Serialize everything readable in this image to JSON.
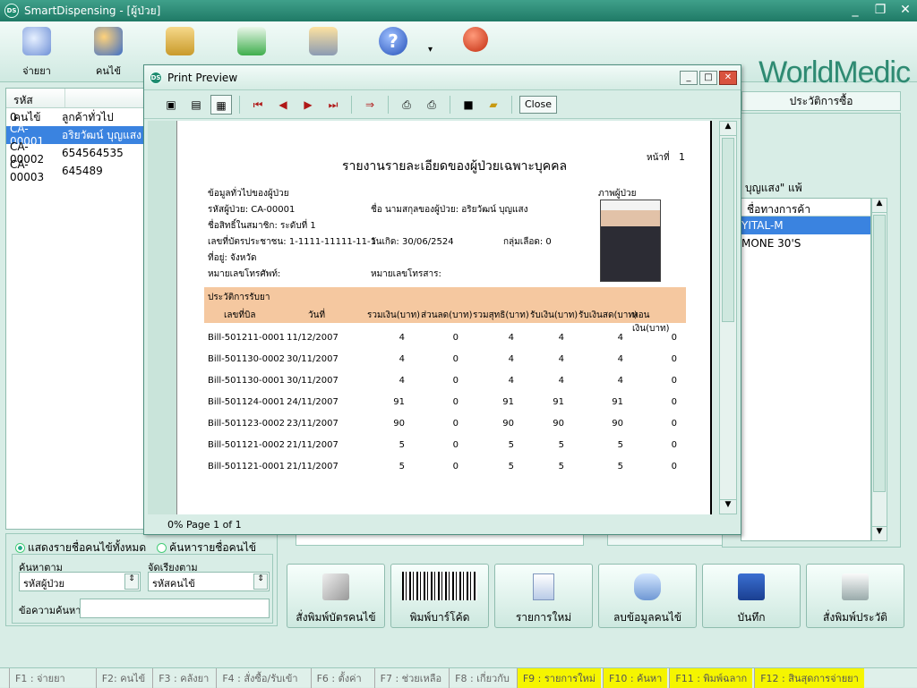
{
  "window": {
    "title": "SmartDispensing - [ผู้ป่วย]",
    "app_icon": "DS",
    "minimize": "_",
    "restore": "❐",
    "close": "✕"
  },
  "toolbar": {
    "buttons": [
      {
        "label": "จ่ายยา",
        "icon": "dispense-icon"
      },
      {
        "label": "คนไข้",
        "icon": "patients-icon"
      },
      {
        "label": "",
        "icon": "stock-icon"
      },
      {
        "label": "",
        "icon": "transfer-icon"
      },
      {
        "label": "",
        "icon": "tools-icon"
      },
      {
        "label": "",
        "icon": "help-icon"
      },
      {
        "label": "",
        "icon": "power-icon"
      }
    ],
    "logo": "WorldMedic"
  },
  "patient_list": {
    "columns": [
      "รหัสคนไข้",
      ""
    ],
    "rows": [
      {
        "code": "0",
        "name": "ลูกค้าทั่วไป"
      },
      {
        "code": "CA-00001",
        "name": "อริยวัฒน์ บุญแสง"
      },
      {
        "code": "CA-00002",
        "name": "654564535"
      },
      {
        "code": "CA-00003",
        "name": "645489"
      }
    ],
    "selected_index": 1
  },
  "search": {
    "radio_all": "แสดงรายชื่อคนไข้ทั้งหมด",
    "radio_search": "ค้นหารายชื่อคนไข้",
    "search_by_label": "ค้นหาตาม",
    "search_by_value": "รหัสผู้ป่วย",
    "sort_by_label": "จัดเรียงตาม",
    "sort_by_value": "รหัสคนไข้",
    "keyword_label": "ข้อความค้นหา",
    "keyword_value": ""
  },
  "right": {
    "tab_label": "ประวัติการซื้อ",
    "group_caption": "ณ์ บุญแสง\" แพ้",
    "allergy_header": "ชื่อทางการค้า",
    "allergy_rows": [
      "YITAL-M",
      "MONE 30'S"
    ]
  },
  "bottom_buttons": [
    {
      "label": "สั่งพิมพ์บัตรคนไข้",
      "icon": "print-card-icon"
    },
    {
      "label": "พิมพ์บาร์โค้ด",
      "icon": "barcode-icon"
    },
    {
      "label": "รายการใหม่",
      "icon": "new-document-icon"
    },
    {
      "label": "ลบข้อมูลคนไข้",
      "icon": "delete-database-icon"
    },
    {
      "label": "บันทึก",
      "icon": "save-icon"
    },
    {
      "label": "สั่งพิมพ์ประวัติ",
      "icon": "printer-icon"
    }
  ],
  "fkeys": [
    {
      "label": "F1 : จ่ายยา",
      "hl": false
    },
    {
      "label": "F2: คนไข้",
      "hl": false
    },
    {
      "label": "F3 : คลังยา",
      "hl": false
    },
    {
      "label": "F4 : สั่งซื้อ/รับเข้า",
      "hl": false
    },
    {
      "label": "F6 : ตั้งค่า",
      "hl": false
    },
    {
      "label": "F7 : ช่วยเหลือ",
      "hl": false
    },
    {
      "label": "F8 : เกี่ยวกับ",
      "hl": false
    },
    {
      "label": "F9 : รายการใหม่",
      "hl": true
    },
    {
      "label": "F10 : ค้นหา",
      "hl": true
    },
    {
      "label": "F11 : พิมพ์ฉลาก",
      "hl": true
    },
    {
      "label": "F12 : สินสุดการจ่ายยา",
      "hl": true
    }
  ],
  "preview": {
    "title": "Print Preview",
    "icon": "DS",
    "close_label": "Close",
    "status": "0% Page 1 of 1",
    "report": {
      "page_label": "หน้าที่",
      "page_no": "1",
      "title": "รายงานรายละเอียดของผู้ป่วยเฉพาะบุคคล",
      "general_info": "ข้อมูลทั่วไปของผู้ป่วย",
      "photo_label": "ภาพผู้ป่วย",
      "patient_code": "รหัสผู้ป่วย: CA-00001",
      "patient_name": "ชื่อ นามสกุลของผู้ป่วย: อริยวัฒน์ บุญแสง",
      "member_type": "ชื่อสิทธิ์ในสมาชิก: ระดับที่ 1",
      "id_card": "เลขที่บัตรประชาชน: 1-1111-11111-11-1",
      "birth_date": "วันเกิด: 30/06/2524",
      "blood_group": "กลุ่มเลือด: 0",
      "address": "ที่อยู่: จังหวัด",
      "phone": "หมายเลขโทรศัพท์:",
      "fax": "หมายเลขโทรสาร:",
      "history_label": "ประวัติการรับยา",
      "columns": [
        "เลขที่บิล",
        "วันที่",
        "รวมเงิน(บาท)",
        "ส่วนลด(บาท)",
        "รวมสุทธิ(บาท)",
        "รับเงิน(บาท)",
        "รับเงินสด(บาท)",
        "ทอนเงิน(บาท)"
      ],
      "rows": [
        [
          "Bill-501211-0001",
          "11/12/2007",
          "4",
          "0",
          "4",
          "4",
          "4",
          "0"
        ],
        [
          "Bill-501130-0002",
          "30/11/2007",
          "4",
          "0",
          "4",
          "4",
          "4",
          "0"
        ],
        [
          "Bill-501130-0001",
          "30/11/2007",
          "4",
          "0",
          "4",
          "4",
          "4",
          "0"
        ],
        [
          "Bill-501124-0001",
          "24/11/2007",
          "91",
          "0",
          "91",
          "91",
          "91",
          "0"
        ],
        [
          "Bill-501123-0002",
          "23/11/2007",
          "90",
          "0",
          "90",
          "90",
          "90",
          "0"
        ],
        [
          "Bill-501121-0002",
          "21/11/2007",
          "5",
          "0",
          "5",
          "5",
          "5",
          "0"
        ],
        [
          "Bill-501121-0001",
          "21/11/2007",
          "5",
          "0",
          "5",
          "5",
          "5",
          "0"
        ]
      ]
    }
  }
}
